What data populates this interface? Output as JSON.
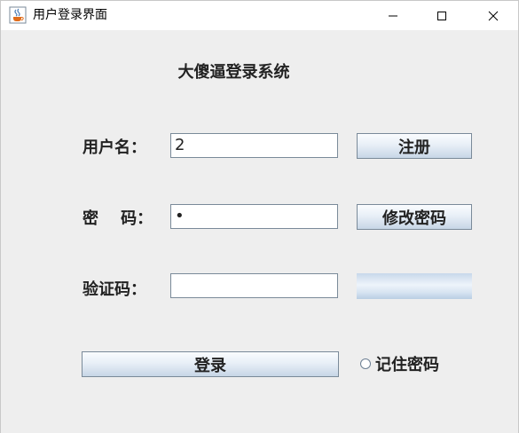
{
  "window": {
    "title": "用户登录界面",
    "icons": {
      "app": "java-cup-icon",
      "minimize": "minimize-icon",
      "maximize": "maximize-icon",
      "close": "close-icon"
    }
  },
  "form": {
    "header": "大傻逼登录系统",
    "username_label": "用户名：",
    "username_value": "2",
    "password_label": "密    码：",
    "password_value": "•",
    "captcha_label": "验证码：",
    "captcha_value": ""
  },
  "buttons": {
    "register": "注册",
    "change_password": "修改密码",
    "login": "登录"
  },
  "remember": {
    "label": "记住密码",
    "checked": false
  },
  "colors": {
    "background": "#eeeeee",
    "button_border": "#7a8a99",
    "field_border": "#7a8a99"
  }
}
